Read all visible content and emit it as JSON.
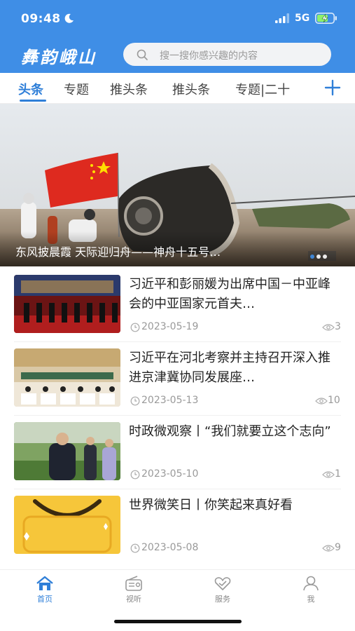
{
  "status_bar": {
    "time": "09:48",
    "network": "5G"
  },
  "header": {
    "brand": "彝韵峨山",
    "search_placeholder": "搜一搜你感兴趣的内容"
  },
  "tabs": [
    {
      "label": "头条",
      "active": true
    },
    {
      "label": "专题",
      "active": false
    },
    {
      "label": "推头条",
      "active": false
    },
    {
      "label": "推头条",
      "active": false
    },
    {
      "label": "专题|二十",
      "active": false
    }
  ],
  "banner": {
    "caption": "东风披晨霞 天际迎归舟——神舟十五号…",
    "slide_count": 3,
    "active_slide": 1
  },
  "news": [
    {
      "title": "习近平和彭丽媛为出席中国－中亚峰会的中亚国家元首夫…",
      "date": "2023-05-19",
      "views": "3"
    },
    {
      "title": "习近平在河北考察并主持召开深入推进京津冀协同发展座…",
      "date": "2023-05-13",
      "views": "10"
    },
    {
      "title": "时政微观察丨“我们就要立这个志向”",
      "date": "2023-05-10",
      "views": "1"
    },
    {
      "title": "世界微笑日丨你笑起来真好看",
      "date": "2023-05-08",
      "views": "9"
    }
  ],
  "tabbar": [
    {
      "label": "首页",
      "icon": "home-icon",
      "active": true
    },
    {
      "label": "视听",
      "icon": "radio-icon",
      "active": false
    },
    {
      "label": "服务",
      "icon": "service-icon",
      "active": false
    },
    {
      "label": "我",
      "icon": "user-icon",
      "active": false
    }
  ],
  "colors": {
    "accent": "#2f7fd8",
    "header": "#3f8ee6"
  }
}
